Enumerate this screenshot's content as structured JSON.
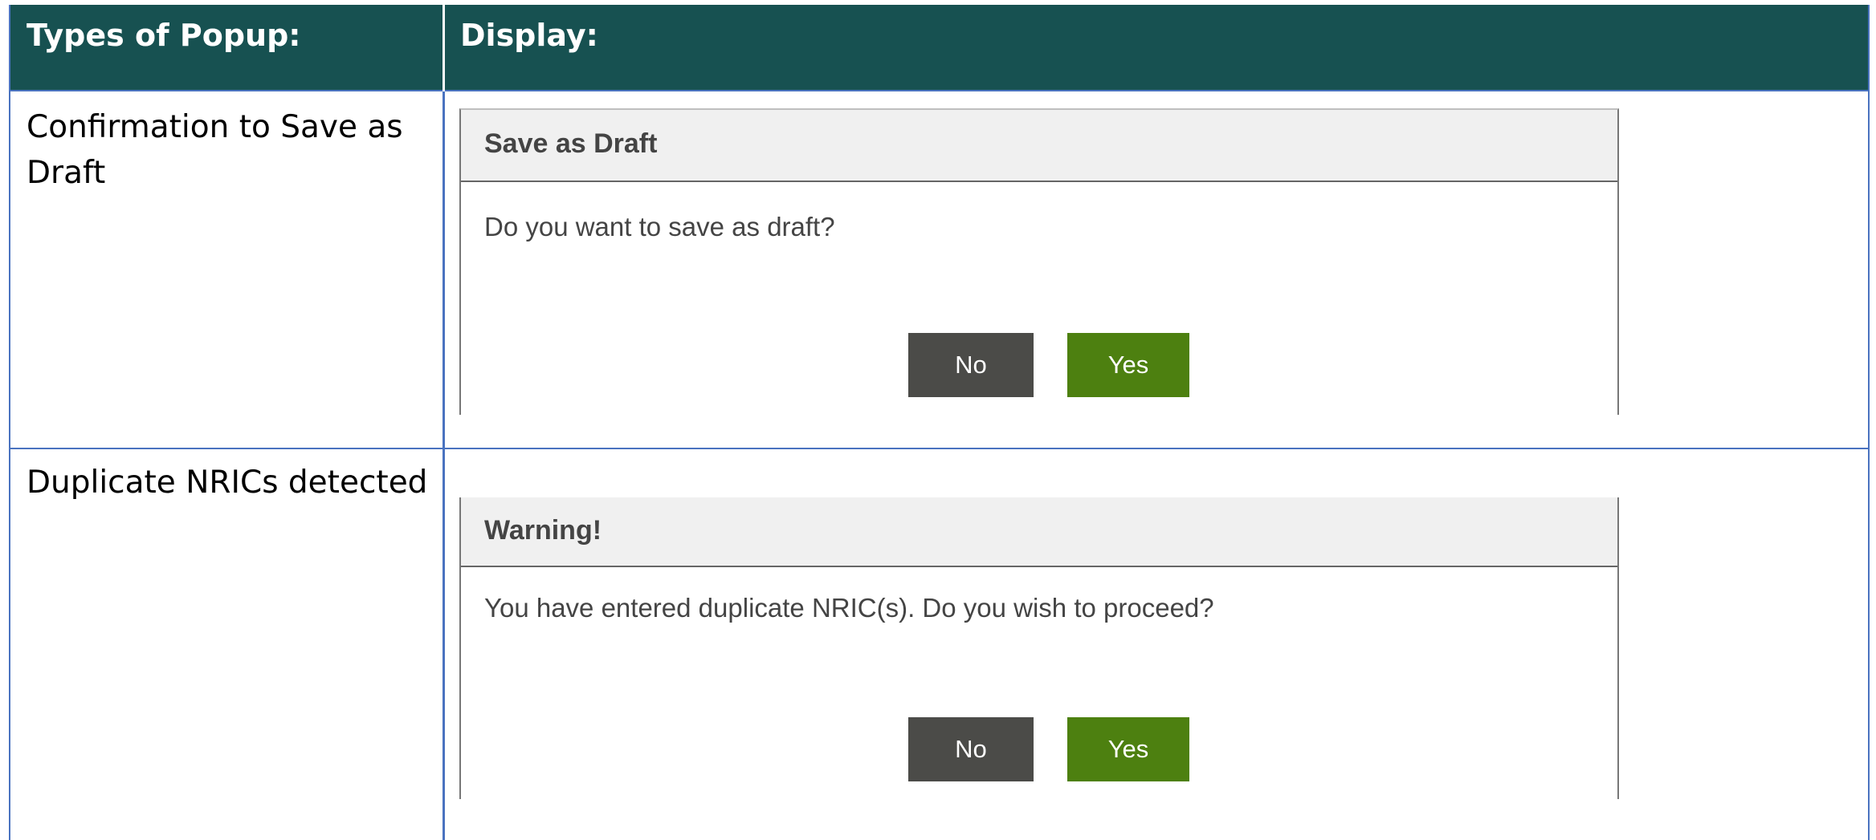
{
  "table": {
    "headers": {
      "type": "Types of Popup:",
      "display": "Display:"
    },
    "rows": [
      {
        "type_label": "Confirmation to Save as Draft",
        "popup": {
          "title": "Save as Draft",
          "message": "Do you want to save as draft?",
          "no_label": "No",
          "yes_label": "Yes"
        }
      },
      {
        "type_label": "Duplicate NRICs detected",
        "popup": {
          "title": "Warning!",
          "message": "You have entered duplicate NRIC(s). Do you wish to proceed?",
          "no_label": "No",
          "yes_label": "Yes"
        }
      }
    ]
  },
  "colors": {
    "header_bg": "#175151",
    "grid_line": "#4a73c0",
    "no_button": "#4b4b48",
    "yes_button": "#4d8010",
    "popup_header_bg": "#f0f0f0"
  }
}
